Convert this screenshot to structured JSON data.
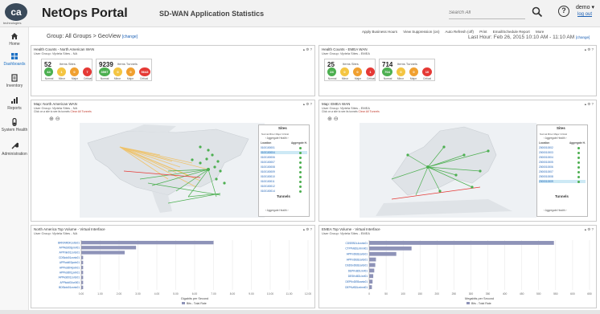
{
  "header": {
    "logo_text": "ca",
    "logo_sub": "technologies",
    "app_title": "NetOps Portal",
    "page_subtitle": "SD-WAN Application Statistics",
    "search_placeholder": "Search All",
    "user": "demo ▾",
    "logout": "log out"
  },
  "sidebar": [
    {
      "label": "Home",
      "icon": "home-icon",
      "active": false
    },
    {
      "label": "Dashboards",
      "icon": "dashboard-icon",
      "active": true
    },
    {
      "label": "Inventory",
      "icon": "inventory-icon",
      "active": false
    },
    {
      "label": "Reports",
      "icon": "reports-icon",
      "active": false
    },
    {
      "label": "System Health",
      "icon": "health-icon",
      "active": false
    },
    {
      "label": "Administration",
      "icon": "wrench-icon",
      "active": false
    }
  ],
  "toolbar": [
    "Apply Business Hours",
    "View Suppression (on)",
    "Auto Refresh (off)",
    "Print",
    "Email/Schedule Report",
    "More"
  ],
  "context": {
    "group_path": "Group: All Groups > GeoView",
    "change": "[change]",
    "time_range": "Last Hour: Feb 26, 2015 10:10 AM - 11:10 AM"
  },
  "health_na": {
    "title": "Health Counts - North American WAN",
    "sub": "User Group: Viptela Sites - NA",
    "sites_total": "52",
    "sites_label": "Items  Sites",
    "tunnels_total": "9239",
    "tunnels_label": "Items  Tunnels",
    "sites": [
      "44",
      "1",
      "0",
      "7"
    ],
    "tunnels": [
      "3597",
      "0",
      "0",
      "5643"
    ]
  },
  "health_emea": {
    "title": "Health Counts - EMEA WAN",
    "sub": "User Group: Viptela Sites - EMEA",
    "sites_total": "25",
    "sites_label": "Items  Sites",
    "tunnels_total": "714",
    "tunnels_label": "Items  Tunnels",
    "sites": [
      "24",
      "0",
      "0",
      "1"
    ],
    "tunnels": [
      "704",
      "0",
      "0",
      "10"
    ]
  },
  "status_labels": [
    "Normal",
    "Minor",
    "Major",
    "Critical"
  ],
  "status_colors": [
    "#4caf50",
    "#f4c542",
    "#f0a030",
    "#e53935"
  ],
  "map_na": {
    "title": "Map: North American WAN",
    "sub": "User Group: Viptela Sites - NA",
    "hint": "Click on a site to see its tunnels",
    "clear": "Clear All Tunnels",
    "legend_sites": "Sites",
    "legend_tunnels": "Tunnels",
    "aggregate": "Aggregate Health",
    "col_location": "Location",
    "col_health": "Aggregate H.",
    "locations": [
      "0100100001",
      "0100100004",
      "0100100006",
      "0100100007",
      "0100100008",
      "0100100009",
      "0100100010",
      "0100100011",
      "0100100012",
      "0100100014"
    ]
  },
  "map_emea": {
    "title": "Map: EMEA WAN",
    "sub": "User Group: Viptela Sites - EMEA",
    "hint": "Click on a site to see its tunnels",
    "clear": "Clear All Tunnels",
    "legend_sites": "Sites",
    "legend_tunnels": "Tunnels",
    "aggregate": "Aggregate Health",
    "col_location": "Location",
    "col_health": "Aggregate H.",
    "locations": [
      "2000010002",
      "2000010003",
      "2000010004",
      "2000010005",
      "2000010006",
      "2000010007",
      "2000010008",
      "2000010009"
    ]
  },
  "vol_na": {
    "title": "North America Top Volume - Virtual Interface",
    "sub": "User Group: Viptela Sites - NA",
    "xlabel": "Gigabits per Second",
    "legend": "Bits - Total Rate"
  },
  "vol_emea": {
    "title": "EMEA Top Volume - Virtual Interface",
    "sub": "User Group: Viptela Sites - EMEA",
    "xlabel": "Megabits per Second",
    "legend": "Bits - Total Rate"
  },
  "chart_data": [
    {
      "type": "bar",
      "orientation": "horizontal",
      "categories": [
        "BRKINRDKzotto01",
        "APPkddl03pmrl01",
        "APPmkl01zorto01",
        "CDSkdd01zorto01",
        "APPkddl03pxln01",
        "APPkddl04pxln01",
        "APPkddl01pxln01",
        "APPkddl01zorto01",
        "APPkddl01sr0l01",
        "BDSkdd01zorto01"
      ],
      "values": [
        7.0,
        2.9,
        2.3,
        0.1,
        0.1,
        0.1,
        0.1,
        0.1,
        0.1,
        0.1
      ],
      "xlim": [
        0,
        12
      ],
      "xticks": [
        "0.00",
        "1.00",
        "2.00",
        "3.00",
        "4.00",
        "5.00",
        "6.00",
        "7.00",
        "8.00",
        "9.00",
        "10.00",
        "11.00",
        "12.00"
      ],
      "xlabel": "Gigabits per Second",
      "legend": [
        "Bits - Total Rate"
      ]
    },
    {
      "type": "bar",
      "orientation": "horizontal",
      "categories": [
        "CDSEBDL4zorto01",
        "CTPPvBDLmhmi01",
        "APPmDEBzarto01",
        "APPmDEBzarto01",
        "DSDSvDEBzarto01",
        "DEPKvBDLlnrl01",
        "DESKvBDLlnrl01",
        "DEPKvDEBzarto01",
        "DEPKvBDLmhmi01"
      ],
      "values": [
        545,
        125,
        80,
        20,
        18,
        15,
        12,
        10,
        8
      ],
      "xlim": [
        0,
        650
      ],
      "xticks": [
        "0",
        "50",
        "100",
        "150",
        "200",
        "250",
        "300",
        "350",
        "400",
        "450",
        "500",
        "550",
        "600",
        "650"
      ],
      "xlabel": "Megabits per Second",
      "legend": [
        "Bits - Total Rate"
      ]
    }
  ]
}
